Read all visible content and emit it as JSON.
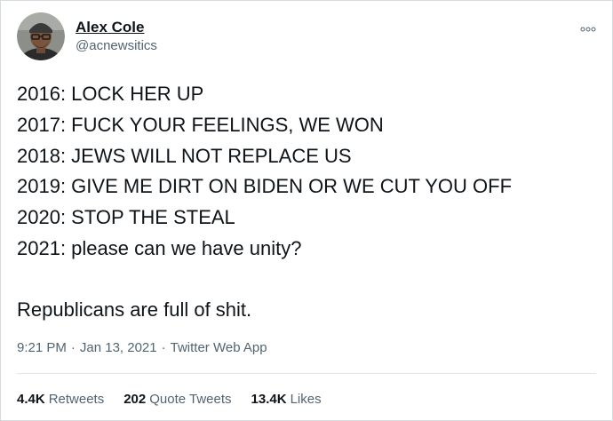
{
  "author": {
    "display_name": "Alex Cole",
    "handle": "@acnewsitics"
  },
  "tweet": {
    "lines": [
      "2016: LOCK HER UP",
      "2017: FUCK YOUR FEELINGS, WE WON",
      "2018: JEWS WILL NOT REPLACE US",
      "2019: GIVE ME DIRT ON BIDEN OR WE CUT YOU OFF",
      "2020: STOP THE STEAL",
      "2021: please can we have unity?"
    ],
    "closing": "Republicans are full of shit."
  },
  "meta": {
    "time": "9:21 PM",
    "separator": "·",
    "date": "Jan 13, 2021",
    "source": "Twitter Web App"
  },
  "stats": {
    "retweets": {
      "count": "4.4K",
      "label": "Retweets"
    },
    "quotes": {
      "count": "202",
      "label": "Quote Tweets"
    },
    "likes": {
      "count": "13.4K",
      "label": "Likes"
    }
  },
  "icons": {
    "more": "more-options-icon",
    "avatar": "avatar-photo"
  }
}
